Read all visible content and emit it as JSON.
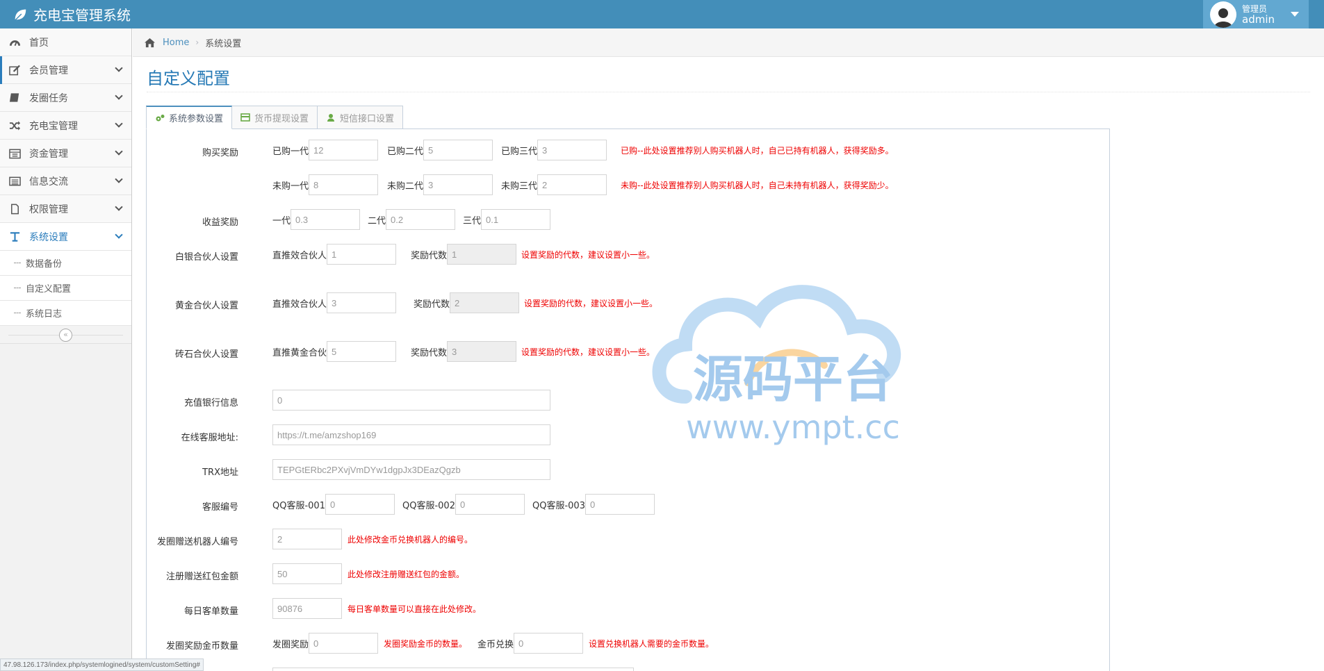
{
  "app": {
    "title": "充电宝管理系统"
  },
  "user": {
    "role": "管理员",
    "name": "admin"
  },
  "sidebar": {
    "items": [
      {
        "label": "首页"
      },
      {
        "label": "会员管理"
      },
      {
        "label": "发圈任务"
      },
      {
        "label": "充电宝管理"
      },
      {
        "label": "资金管理"
      },
      {
        "label": "信息交流"
      },
      {
        "label": "权限管理"
      },
      {
        "label": "系统设置"
      }
    ],
    "subitems": [
      {
        "label": "数据备份"
      },
      {
        "label": "自定义配置"
      },
      {
        "label": "系统日志"
      }
    ]
  },
  "breadcrumb": {
    "home": "Home",
    "current": "系统设置"
  },
  "page": {
    "title": "自定义配置"
  },
  "tabs": [
    {
      "label": "系统参数设置"
    },
    {
      "label": "货币提现设置"
    },
    {
      "label": "短信接口设置"
    }
  ],
  "form": {
    "buy_reward": {
      "label": "购买奖励",
      "bought_1_label": "已购一代",
      "bought_1": "12",
      "bought_2_label": "已购二代",
      "bought_2": "5",
      "bought_3_label": "已购三代",
      "bought_3": "3",
      "bought_hint": "已购--此处设置推荐别人购买机器人时，自己已持有机器人，获得奖励多。",
      "unbought_1_label": "未购一代",
      "unbought_1": "8",
      "unbought_2_label": "未购二代",
      "unbought_2": "3",
      "unbought_3_label": "未购三代",
      "unbought_3": "2",
      "unbought_hint": "未购--此处设置推荐别人购买机器人时，自己未持有机器人，获得奖励少。"
    },
    "income_reward": {
      "label": "收益奖励",
      "g1_label": "一代",
      "g1": "0.3",
      "g2_label": "二代",
      "g2": "0.2",
      "g3_label": "三代",
      "g3": "0.1"
    },
    "silver": {
      "label": "白银合伙人设置",
      "direct_label": "直推效合伙人",
      "direct": "1",
      "gen_label": "奖励代数",
      "gen": "1",
      "hint": "设置奖励的代数，建议设置小一些。"
    },
    "gold": {
      "label": "黄金合伙人设置",
      "direct_label": "直推效合伙人",
      "direct": "3",
      "gen_label": "奖励代数",
      "gen": "2",
      "hint": "设置奖励的代数，建议设置小一些。"
    },
    "diamond": {
      "label": "砖石合伙人设置",
      "direct_label": "直推黄金合伙",
      "direct": "5",
      "gen_label": "奖励代数",
      "gen": "3",
      "hint": "设置奖励的代数，建议设置小一些。"
    },
    "bank": {
      "label": "充值银行信息",
      "value": "0"
    },
    "service_url": {
      "label": "在线客服地址:",
      "value": "https://t.me/amzshop169"
    },
    "trx": {
      "label": "TRX地址",
      "value": "TEPGtERbc2PXvjVmDYw1dgpJx3DEazQgzb"
    },
    "service_no": {
      "label": "客服编号",
      "qq1_label": "QQ客服-001",
      "qq1": "0",
      "qq2_label": "QQ客服-002",
      "qq2": "0",
      "qq3_label": "QQ客服-003",
      "qq3": "0"
    },
    "gift_robot": {
      "label": "发圈赠送机器人编号",
      "value": "2",
      "hint": "此处修改金币兑换机器人的编号。"
    },
    "reg_bonus": {
      "label": "注册赠送红包金额",
      "value": "50",
      "hint": "此处修改注册赠送红包的金额。"
    },
    "daily_orders": {
      "label": "每日客单数量",
      "value": "90876",
      "hint": "每日客单数量可以直接在此处修改。"
    },
    "coin_reward": {
      "label": "发圈奖励金币数量",
      "reward_label": "发圈奖励",
      "reward": "0",
      "reward_hint": "发圈奖励金币的数量。",
      "exchange_label": "金币兑换",
      "exchange": "0",
      "exchange_hint": "设置兑换机器人需要的金币数量。"
    }
  },
  "watermark": {
    "title": "源码平台",
    "url": "www.ympt.cc"
  },
  "statusbar": {
    "url": "47.98.126.173/index.php/systemlogined/system/customSetting#"
  },
  "colors": {
    "navbar": "#438eb9",
    "accent": "#2679b5",
    "hint": "#e00000"
  }
}
